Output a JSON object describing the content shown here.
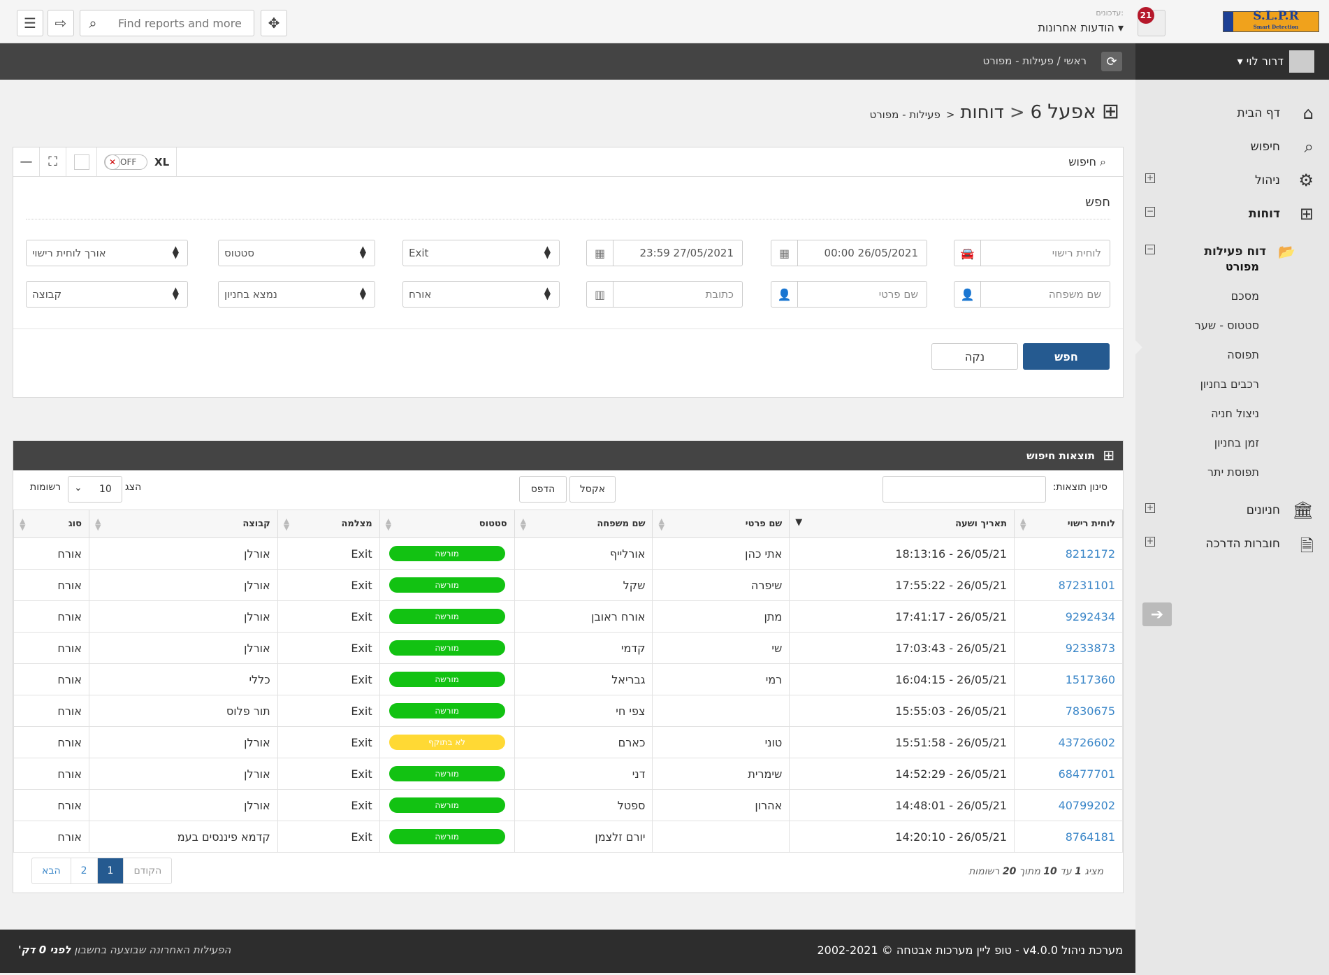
{
  "topbar": {
    "search_placeholder": "Find reports and more",
    "notif_sub": "עדכונים:",
    "notif_title": "הודעות אחרונות",
    "notif_count": "21",
    "logo_text": "S.L.P.R",
    "logo_sub": "Smart Detection"
  },
  "breadcrumb": {
    "home": "ראשי",
    "sep": "/",
    "current": "פעילות - מפורט"
  },
  "sidebar": {
    "user": "דרור לוי",
    "items": [
      {
        "label": "דף הבית",
        "icon": "home-icon"
      },
      {
        "label": "חיפוש",
        "icon": "search-icon"
      },
      {
        "label": "ניהול",
        "icon": "gear-icon"
      },
      {
        "label": "דוחות",
        "icon": "grid-icon"
      },
      {
        "label": "דוח פעילות",
        "icon": "folder-open-icon"
      },
      {
        "label": "חניונים",
        "icon": "bank-icon"
      },
      {
        "label": "חוברות הדרכה",
        "icon": "file-pdf-icon"
      }
    ],
    "sub_items": [
      "מפורט",
      "מסכם",
      "סטטוס - שער",
      "תפוסה",
      "רכבים בחניון",
      "ניצול חניה",
      "זמן בחניון",
      "תפוסת יתר"
    ]
  },
  "page_title": {
    "site": "אפעל",
    "num": "6",
    "section": "דוחות",
    "sub": "פעילות - מפורט"
  },
  "search_panel": {
    "title": "חיפוש",
    "toggle_off": "OFF",
    "xl": "XL",
    "heading": "חפש",
    "row1": {
      "plate_ph": "לוחית רישוי",
      "from_date": "00:00 26/05/2021",
      "to_date": "23:59 27/05/2021",
      "direction": "Exit",
      "status": "סטטוס",
      "plate_len": "אורך לוחית רישוי"
    },
    "row2": {
      "last_name_ph": "שם משפחה",
      "first_name_ph": "שם פרטי",
      "address_ph": "כתובת",
      "type": "אורח",
      "in_lot": "נמצא בחניון",
      "group": "קבוצה"
    },
    "search_btn": "חפש",
    "clear_btn": "נקה"
  },
  "results": {
    "title": "תוצאות חיפוש",
    "filter_label": "סינון תוצאות:",
    "excel_btn": "אקסל",
    "print_btn": "הדפס",
    "show_label": "הצג",
    "show_value": "10",
    "records_label": "רשומות",
    "columns": [
      "לוחית רישוי",
      "תאריך ושעה",
      "שם פרטי",
      "שם משפחה",
      "סטטוס",
      "מצלמה",
      "קבוצה",
      "סוג"
    ],
    "rows": [
      {
        "plate": "8212172",
        "datetime": "18:13:16 - 26/05/21",
        "first": "אתי כהן",
        "last": "אורלייף",
        "status": "מורשה",
        "status_type": "ok",
        "camera": "Exit",
        "group": "אורלן",
        "type": "אורח"
      },
      {
        "plate": "87231101",
        "datetime": "17:55:22 - 26/05/21",
        "first": "שיפרה",
        "last": "שקל",
        "status": "מורשה",
        "status_type": "ok",
        "camera": "Exit",
        "group": "אורלן",
        "type": "אורח"
      },
      {
        "plate": "9292434",
        "datetime": "17:41:17 - 26/05/21",
        "first": "מתן",
        "last": "אורח ראובן",
        "status": "מורשה",
        "status_type": "ok",
        "camera": "Exit",
        "group": "אורלן",
        "type": "אורח"
      },
      {
        "plate": "9233873",
        "datetime": "17:03:43 - 26/05/21",
        "first": "שי",
        "last": "קדמי",
        "status": "מורשה",
        "status_type": "ok",
        "camera": "Exit",
        "group": "אורלן",
        "type": "אורח"
      },
      {
        "plate": "1517360",
        "datetime": "16:04:15 - 26/05/21",
        "first": "רמי",
        "last": "גבריאל",
        "status": "מורשה",
        "status_type": "ok",
        "camera": "Exit",
        "group": "כללי",
        "type": "אורח"
      },
      {
        "plate": "7830675",
        "datetime": "15:55:03 - 26/05/21",
        "first": "",
        "last": "צפי חי",
        "status": "מורשה",
        "status_type": "ok",
        "camera": "Exit",
        "group": "תור פלוס",
        "type": "אורח"
      },
      {
        "plate": "43726602",
        "datetime": "15:51:58 - 26/05/21",
        "first": "טוני",
        "last": "כארם",
        "status": "לא בתוקף",
        "status_type": "warn",
        "camera": "Exit",
        "group": "אורלן",
        "type": "אורח"
      },
      {
        "plate": "68477701",
        "datetime": "14:52:29 - 26/05/21",
        "first": "שימרית",
        "last": "דני",
        "status": "מורשה",
        "status_type": "ok",
        "camera": "Exit",
        "group": "אורלן",
        "type": "אורח"
      },
      {
        "plate": "40799202",
        "datetime": "14:48:01 - 26/05/21",
        "first": "אהרון",
        "last": "ספטל",
        "status": "מורשה",
        "status_type": "ok",
        "camera": "Exit",
        "group": "אורלן",
        "type": "אורח"
      },
      {
        "plate": "8764181",
        "datetime": "14:20:10 - 26/05/21",
        "first": "",
        "last": "יורם זלצמן",
        "status": "מורשה",
        "status_type": "ok",
        "camera": "Exit",
        "group": "קדמא פיננסים בעמ",
        "type": "אורח"
      }
    ],
    "pager": {
      "prev": "הקודם",
      "page1": "1",
      "page2": "2",
      "next": "הבא"
    },
    "showing": {
      "pre": "מציג",
      "from": "1",
      "mid1": "עד",
      "to": "10",
      "mid2": "מתוך",
      "total": "20",
      "post": "רשומות"
    }
  },
  "footer": {
    "copyright": "מערכת ניהול v4.0.0 - טופ ליין מערכות אבטחה © 2002-2021",
    "last_activity": "הפעילות האחרונה שבוצעה בחשבון",
    "ago": "לפני 0 דק'"
  }
}
